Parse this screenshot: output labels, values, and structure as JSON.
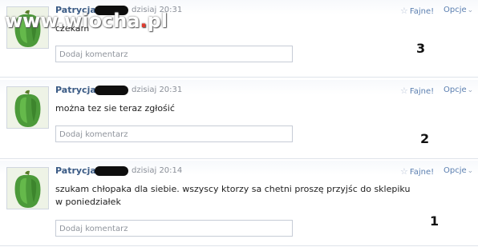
{
  "posts": [
    {
      "author": "Patrycja",
      "time": "dzisiaj 20:31",
      "text": "czekam",
      "comment_placeholder": "Dodaj komentarz",
      "like_label": "Fajne!",
      "options_label": "Opcje",
      "number": "3"
    },
    {
      "author": "Patrycja",
      "time": "dzisiaj 20:31",
      "text": "można tez sie teraz zgłośić",
      "comment_placeholder": "Dodaj komentarz",
      "like_label": "Fajne!",
      "options_label": "Opcje",
      "number": "2"
    },
    {
      "author": "Patrycja",
      "time": "dzisiaj 20:14",
      "text": "szukam chłopaka dla siebie. wszyscy ktorzy sa chetni proszę przyjśc do sklepiku w poniedziałek",
      "comment_placeholder": "Dodaj komentarz",
      "like_label": "Fajne!",
      "options_label": "Opcje",
      "number": "1"
    }
  ],
  "watermark": {
    "text_main": "www.wiocha",
    "text_dot": ".",
    "text_tld": "pl"
  },
  "icons": {
    "like": "star-icon",
    "options": "chevron-down-icon",
    "avatar": "green-pepper-avatar"
  },
  "colors": {
    "author": "#3b5b85",
    "link": "#5b7fb0",
    "muted": "#8a8f98",
    "border": "#c6ccd6"
  }
}
